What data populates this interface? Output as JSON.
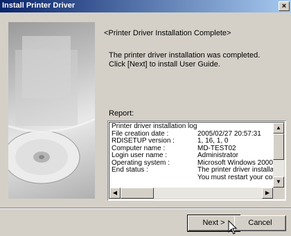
{
  "window": {
    "title": "Install Printer Driver",
    "close_label": "×"
  },
  "main": {
    "heading": "<Printer Driver Installation Complete>",
    "message_line1": "The printer driver installation was completed.",
    "message_line2": "Click [Next] to install User Guide.",
    "report_label": "Report:"
  },
  "report": {
    "title": "Printer driver installation log",
    "rows": [
      {
        "key": "File creation date :",
        "value": "2005/02/27 20:57:31"
      },
      {
        "key": "RDISETUP version :",
        "value": "1, 16, 1, 0"
      },
      {
        "key": "Computer name :",
        "value": "MD-TEST02"
      },
      {
        "key": "Login user name :",
        "value": "Administrator"
      },
      {
        "key": "Operating system :",
        "value": "Microsoft Windows 2000"
      },
      {
        "key": "End status :",
        "value": "The printer driver installatio"
      }
    ],
    "last_line": "You must restart your comp"
  },
  "buttons": {
    "next": "Next >",
    "cancel": "Cancel"
  }
}
